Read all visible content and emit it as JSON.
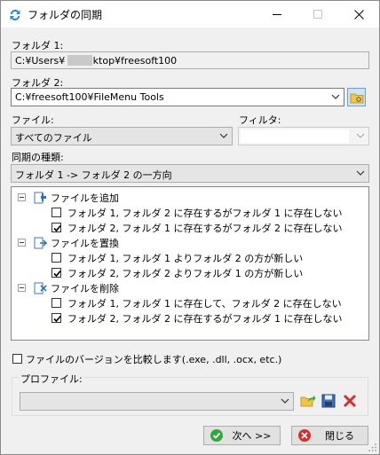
{
  "window": {
    "title": "フォルダの同期"
  },
  "folder1": {
    "label": "フォルダ 1:",
    "value": "C:¥Users¥        ¥Desktop¥freesoft100"
  },
  "folder2": {
    "label": "フォルダ 2:",
    "value": "C:¥freesoft100¥FileMenu Tools"
  },
  "file": {
    "label": "ファイル:",
    "value": "すべてのファイル"
  },
  "filter": {
    "label": "フィルタ:",
    "value": ""
  },
  "sync_type": {
    "label": "同期の種類:",
    "value": "フォルダ 1 -> フォルダ 2 の一方向"
  },
  "tree": {
    "groups": [
      {
        "label": "ファイルを追加",
        "icon": "add-file-icon",
        "items": [
          {
            "label": "フォルダ 1, フォルダ 2 に存在するがフォルダ 1 に存在しない",
            "checked": false
          },
          {
            "label": "フォルダ 2, フォルダ 1 に存在するがフォルダ 2 に存在しない",
            "checked": true
          }
        ]
      },
      {
        "label": "ファイルを置換",
        "icon": "replace-file-icon",
        "items": [
          {
            "label": "フォルダ 1, フォルダ 1 よりフォルダ 2 の方が新しい",
            "checked": false
          },
          {
            "label": "フォルダ 2, フォルダ 2 よりフォルダ 1 の方が新しい",
            "checked": true
          }
        ]
      },
      {
        "label": "ファイルを削除",
        "icon": "delete-file-icon",
        "items": [
          {
            "label": "フォルダ 1, フォルダ 1 に存在して、フォルダ 2 に存在しない",
            "checked": false
          },
          {
            "label": "フォルダ 2, フォルダ 2 に存在するがフォルダ 1 に存在しない",
            "checked": true
          }
        ]
      }
    ]
  },
  "compare_version": {
    "label": "ファイルのバージョンを比較します(.exe, .dll, .ocx, etc.)",
    "checked": false
  },
  "profile": {
    "label": "プロファイル:",
    "value": ""
  },
  "buttons": {
    "next": "次へ >>",
    "close": "閉じる"
  },
  "colors": {
    "accent": "#0078d7",
    "ok_green": "#2eaa3c",
    "cancel_red": "#d32f2f"
  }
}
